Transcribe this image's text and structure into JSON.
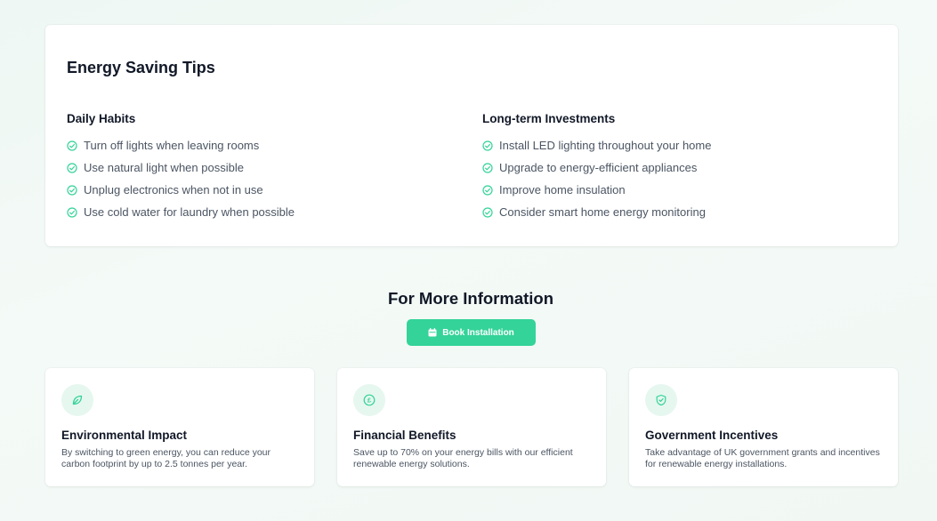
{
  "colors": {
    "accent": "#34d399",
    "icon_bg": "#e6f7ef",
    "check": "#34d399"
  },
  "tips": {
    "title": "Energy Saving Tips",
    "daily": {
      "title": "Daily Habits",
      "items": [
        "Turn off lights when leaving rooms",
        "Use natural light when possible",
        "Unplug electronics when not in use",
        "Use cold water for laundry when possible"
      ]
    },
    "longterm": {
      "title": "Long-term Investments",
      "items": [
        "Install LED lighting throughout your home",
        "Upgrade to energy-efficient appliances",
        "Improve home insulation",
        "Consider smart home energy monitoring"
      ]
    }
  },
  "more_info": {
    "title": "For More Information",
    "button_label": "Book Installation",
    "button_icon": "calendar-icon"
  },
  "features": [
    {
      "icon": "leaf-icon",
      "title": "Environmental Impact",
      "description": "By switching to green energy, you can reduce your carbon footprint by up to 2.5 tonnes per year."
    },
    {
      "icon": "pound-coin-icon",
      "title": "Financial Benefits",
      "description": "Save up to 70% on your energy bills with our efficient renewable energy solutions."
    },
    {
      "icon": "shield-check-icon",
      "title": "Government Incentives",
      "description": "Take advantage of UK government grants and incentives for renewable energy installations."
    }
  ]
}
